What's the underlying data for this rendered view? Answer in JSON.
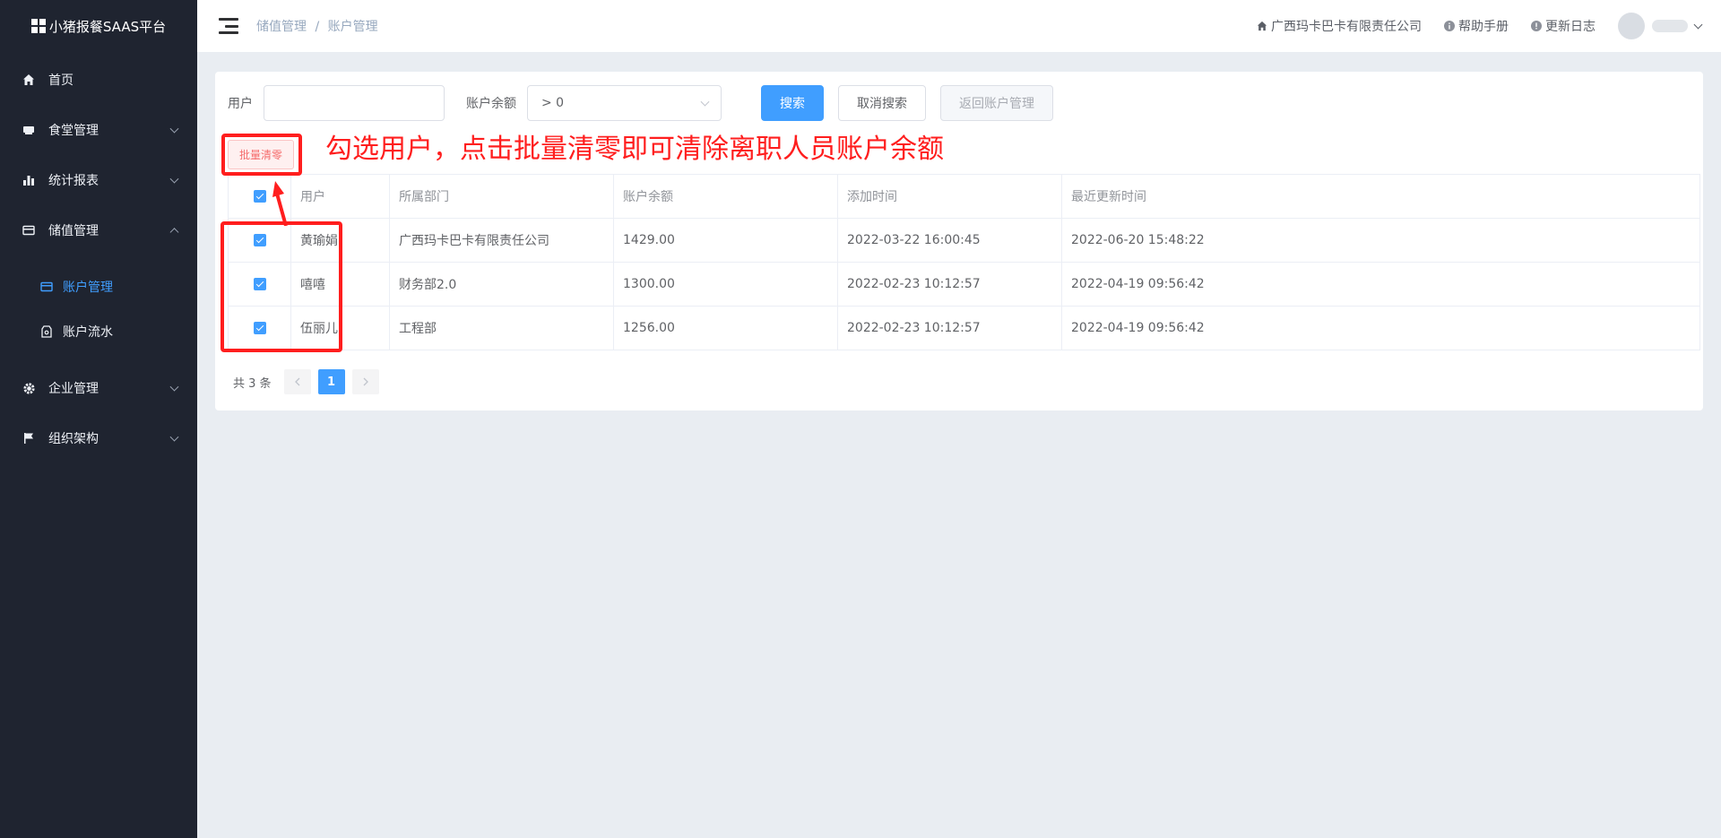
{
  "app": {
    "title": "小猪报餐SAAS平台"
  },
  "sidebar": {
    "items": [
      {
        "label": "首页"
      },
      {
        "label": "食堂管理"
      },
      {
        "label": "统计报表"
      },
      {
        "label": "储值管理"
      },
      {
        "label": "企业管理"
      },
      {
        "label": "组织架构"
      }
    ],
    "subitems": [
      {
        "label": "账户管理"
      },
      {
        "label": "账户流水"
      }
    ]
  },
  "header": {
    "breadcrumb": [
      "储值管理",
      "账户管理"
    ],
    "breadcrumb_sep": "/",
    "company": "广西玛卡巴卡有限责任公司",
    "help": "帮助手册",
    "changelog": "更新日志"
  },
  "filters": {
    "user_label": "用户",
    "user_value": "",
    "balance_label": "账户余额",
    "balance_value": "> 0",
    "search_label": "搜索",
    "cancel_label": "取消搜索",
    "back_label": "返回账户管理"
  },
  "batch_clear_label": "批量清零",
  "annotation": "勾选用户，点击批量清零即可清除离职人员账户余额",
  "table": {
    "headers": [
      "用户",
      "所属部门",
      "账户余额",
      "添加时间",
      "最近更新时间"
    ],
    "rows": [
      {
        "user": "黄瑜娟",
        "dept": "广西玛卡巴卡有限责任公司",
        "balance": "1429.00",
        "added": "2022-03-22 16:00:45",
        "updated": "2022-06-20 15:48:22"
      },
      {
        "user": "嘻嘻",
        "dept": "财务部2.0",
        "balance": "1300.00",
        "added": "2022-02-23 10:12:57",
        "updated": "2022-04-19 09:56:42"
      },
      {
        "user": "伍丽儿",
        "dept": "工程部",
        "balance": "1256.00",
        "added": "2022-02-23 10:12:57",
        "updated": "2022-04-19 09:56:42"
      }
    ]
  },
  "pagination": {
    "total": "共 3 条",
    "current": "1"
  },
  "colors": {
    "primary": "#409eff",
    "sidebar_bg": "#1f2430",
    "annotation": "#ff1e1e",
    "danger": "#f56c6c"
  }
}
